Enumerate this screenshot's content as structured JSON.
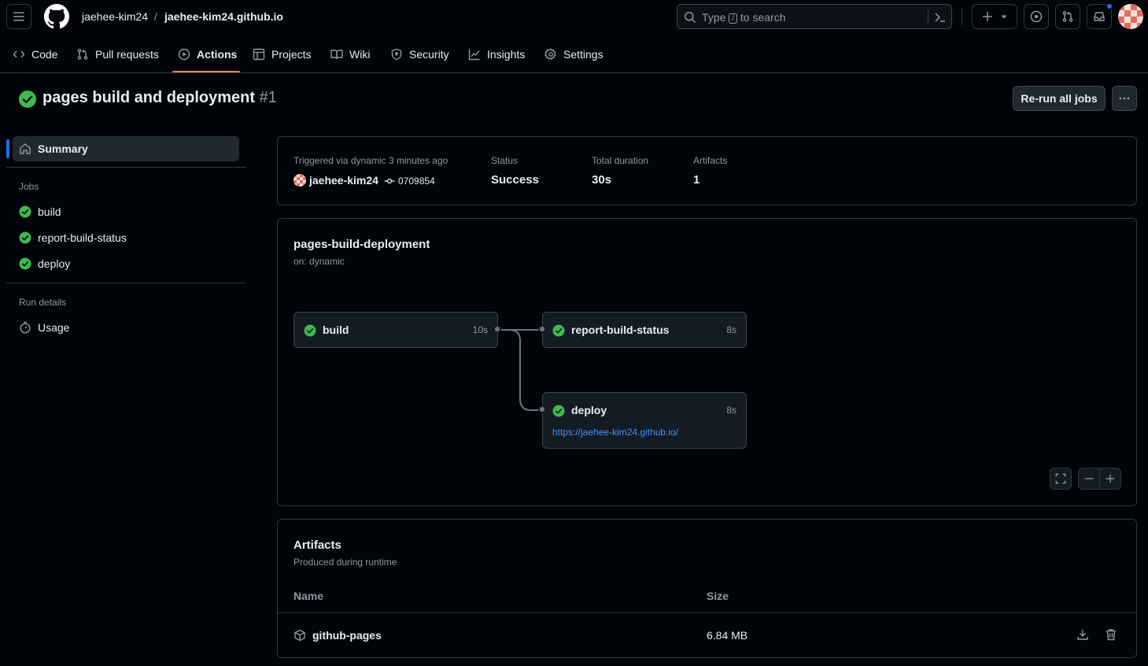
{
  "header": {
    "owner": "jaehee-kim24",
    "separator": "/",
    "repo": "jaehee-kim24.github.io",
    "search_prefix": "Type",
    "search_key": "/",
    "search_suffix": "to search"
  },
  "nav": {
    "tabs": [
      {
        "label": "Code",
        "icon": "code-icon"
      },
      {
        "label": "Pull requests",
        "icon": "git-pull-request-icon"
      },
      {
        "label": "Actions",
        "icon": "play-icon",
        "active": true
      },
      {
        "label": "Projects",
        "icon": "table-icon"
      },
      {
        "label": "Wiki",
        "icon": "book-icon"
      },
      {
        "label": "Security",
        "icon": "shield-icon"
      },
      {
        "label": "Insights",
        "icon": "graph-icon"
      },
      {
        "label": "Settings",
        "icon": "gear-icon"
      }
    ]
  },
  "run": {
    "title": "pages build and deployment",
    "number": "#1",
    "rerun_label": "Re-run all jobs"
  },
  "sidebar": {
    "summary_label": "Summary",
    "jobs_heading": "Jobs",
    "jobs": [
      "build",
      "report-build-status",
      "deploy"
    ],
    "run_details_heading": "Run details",
    "usage_label": "Usage"
  },
  "summary": {
    "trigger_label": "Triggered via dynamic 3 minutes ago",
    "actor": "jaehee-kim24",
    "commit": "0709854",
    "status_label": "Status",
    "status_value": "Success",
    "duration_label": "Total duration",
    "duration_value": "30s",
    "artifacts_label": "Artifacts",
    "artifacts_value": "1"
  },
  "workflow": {
    "name": "pages-build-deployment",
    "trigger": "on: dynamic",
    "jobs": [
      {
        "name": "build",
        "duration": "10s"
      },
      {
        "name": "report-build-status",
        "duration": "8s"
      },
      {
        "name": "deploy",
        "duration": "8s",
        "url": "https://jaehee-kim24.github.io/"
      }
    ]
  },
  "artifacts": {
    "title": "Artifacts",
    "subtitle": "Produced during runtime",
    "col_name": "Name",
    "col_size": "Size",
    "rows": [
      {
        "name": "github-pages",
        "size": "6.84 MB"
      }
    ]
  },
  "colors": {
    "success": "#3fb950",
    "accent_underline": "#f78166",
    "link": "#4493f8",
    "notification": "#1f6feb"
  }
}
